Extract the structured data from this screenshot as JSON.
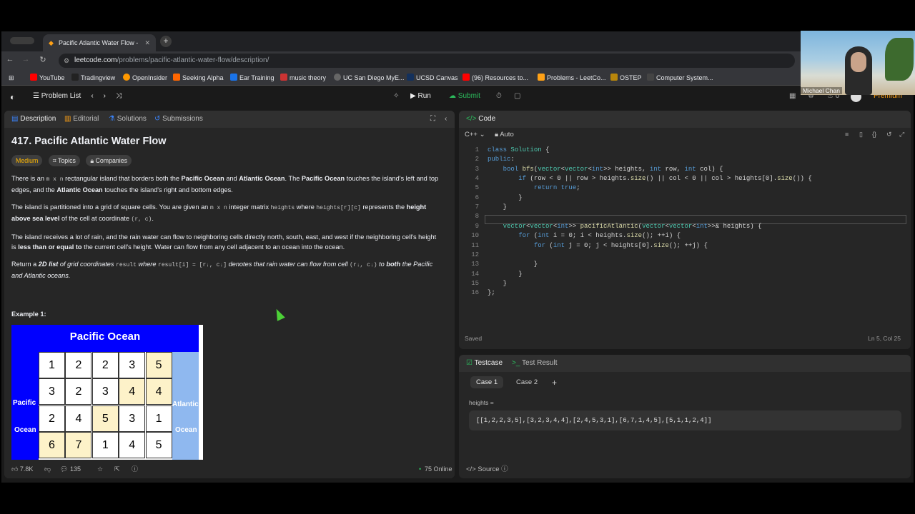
{
  "browser": {
    "tab_title": "Pacific Atlantic Water Flow -",
    "url_host": "leetcode.com",
    "url_path": "/problems/pacific-atlantic-water-flow/description/",
    "bookmarks": [
      "YouTube",
      "Tradingview",
      "OpenInsider",
      "Seeking Alpha",
      "Ear Training",
      "music theory",
      "UC San Diego MyE...",
      "UCSD Canvas",
      "(96) Resources to...",
      "Problems - LeetCo...",
      "OSTEP",
      "Computer System..."
    ]
  },
  "topbar": {
    "problem_list": "Problem List",
    "run": "Run",
    "submit": "Submit",
    "premium": "Premium",
    "streak": "0"
  },
  "desc_tabs": [
    "Description",
    "Editorial",
    "Solutions",
    "Submissions"
  ],
  "problem": {
    "title": "417. Pacific Atlantic Water Flow",
    "difficulty": "Medium",
    "topics": "Topics",
    "companies": "Companies",
    "p1a": "There is an ",
    "p1code": "m x n",
    "p1b": " rectangular island that borders both the ",
    "pacific": "Pacific Ocean",
    "and": " and ",
    "atlantic": "Atlantic Ocean",
    "p1c": ". The ",
    "p1d": " touches the island's left and top edges, and the ",
    "p1e": " touches the island's right and bottom edges.",
    "p2a": "The island is partitioned into a grid of square cells. You are given an ",
    "p2code": "m x n",
    "p2b": " integer matrix ",
    "p2code2": "heights",
    "p2c": " where ",
    "p2code3": "heights[r][c]",
    "p2d": " represents the ",
    "p2bold": "height above sea level",
    "p2e": " of the cell at coordinate ",
    "p2code4": "(r, c)",
    "p2f": ".",
    "p3a": "The island receives a lot of rain, and the rain water can flow to neighboring cells directly north, south, east, and west if the neighboring cell's height is ",
    "p3bold": "less than or equal to",
    "p3b": " the current cell's height. Water can flow from any cell adjacent to an ocean into the ocean.",
    "p4a": "Return a ",
    "p4bold": "2D list",
    "p4b": " of grid coordinates ",
    "p4code": "result",
    "p4c": " where ",
    "p4code2": "result[i] = [rᵢ, cᵢ]",
    "p4d": " denotes that rain water can flow from cell ",
    "p4code3": "(rᵢ, cᵢ)",
    "p4e": " to ",
    "p4bold2": "both",
    "p4f": " the Pacific and Atlantic oceans.",
    "example": "Example 1:"
  },
  "figure": {
    "pacific_label": "Pacific Ocean",
    "left_label_1": "Pacific",
    "left_label_2": "Ocean",
    "right_label_1": "Atlantic",
    "right_label_2": "Ocean",
    "rows": [
      [
        1,
        2,
        2,
        3,
        5
      ],
      [
        3,
        2,
        3,
        4,
        4
      ],
      [
        2,
        4,
        5,
        3,
        1
      ],
      [
        6,
        7,
        1,
        4,
        5
      ]
    ],
    "highlight": [
      [
        0,
        0,
        0,
        0,
        1
      ],
      [
        0,
        0,
        0,
        1,
        1
      ],
      [
        0,
        0,
        1,
        0,
        0
      ],
      [
        1,
        1,
        0,
        0,
        0
      ]
    ]
  },
  "desc_footer": {
    "likes": "7.8K",
    "comments": "135",
    "online": "75 Online"
  },
  "code_panel": {
    "title": "Code",
    "lang": "C++",
    "auto": "Auto",
    "saved": "Saved",
    "cursor": "Ln 5, Col 25",
    "lines": [
      "class Solution {",
      "public:",
      "    bool bfs(vector<vector<int>> heights, int row, int col) {",
      "        if (row < 0 || row > heights.size() || col < 0 || col > heights[0].size()) {",
      "            return true;",
      "        }",
      "    }",
      "",
      "    vector<vector<int>> pacificAtlantic(vector<vector<int>>& heights) {",
      "        for (int i = 0; i < heights.size(); ++i) {",
      "            for (int j = 0; j < heights[0].size(); ++j) {",
      "",
      "            }",
      "        }",
      "    }",
      "};"
    ]
  },
  "testcase": {
    "tab1": "Testcase",
    "tab2": "Test Result",
    "case1": "Case 1",
    "case2": "Case 2",
    "label": "heights =",
    "value": "[[1,2,2,3,5],[3,2,3,4,4],[2,4,5,3,1],[6,7,1,4,5],[5,1,1,2,4]]",
    "source": "Source"
  },
  "webcam": {
    "name": "Michael Chan"
  }
}
